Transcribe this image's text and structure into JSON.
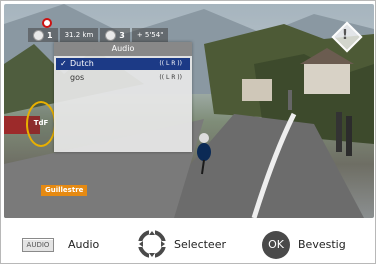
{
  "race_info": {
    "stage_number": "1",
    "distance": "31.2 km",
    "group_number": "3",
    "time_gap": "+ 5'54\""
  },
  "audio_menu": {
    "title": "Audio",
    "options": [
      {
        "label": "Dutch",
        "selected": true,
        "channels": "(( L R ))"
      },
      {
        "label": "gos",
        "selected": false,
        "channels": "(( L R ))"
      }
    ]
  },
  "overlay": {
    "location": "Guillestre",
    "broadcaster_logo_text": "TdF"
  },
  "help_bar": {
    "audio_key": "AUDIO",
    "audio_label": "Audio",
    "select_label": "Selecteer",
    "ok_key": "OK",
    "confirm_label": "Bevestig"
  },
  "colors": {
    "selected_row": "#1c3a86",
    "location_tag": "#e68a12",
    "ok_button": "#4a4a4a"
  }
}
